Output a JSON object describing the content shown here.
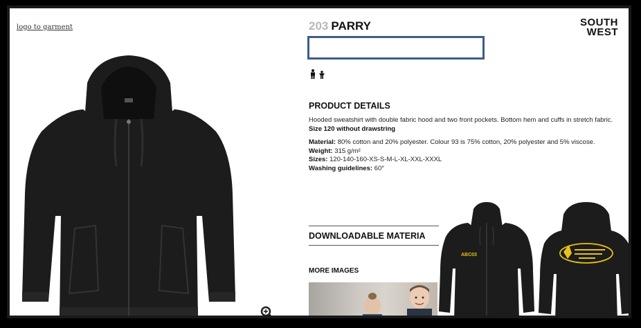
{
  "logo_link": "logo to garment",
  "product": {
    "number": "203",
    "name": "PARRY"
  },
  "brand_line1": "SOUTH",
  "brand_line2": "WEST",
  "details": {
    "heading": "PRODUCT DETAILS",
    "description": "Hooded sweatshirt with double fabric hood and two front pockets. Bottom hem and cuffs in stretch fabric.",
    "note": "Size 120 without drawstring",
    "material_label": "Material:",
    "material_value": " 80% cotton and 20% polyester. Colour 93 is 75% cotton, 20% polyester and 5% viscose.",
    "weight_label": "Weight:",
    "weight_value": " 315 g/m²",
    "sizes_label": "Sizes:",
    "sizes_value": " 120-140-160-XS-S-M-L-XL-XXL-XXXL",
    "washing_label": "Washing guidelines:",
    "washing_value": " 60°"
  },
  "downloadable": "DOWNLOADABLE MATERIA",
  "more_images": "MORE IMAGES",
  "print_front_text": "ABC03",
  "colors": {
    "garment": "#1c1c1c",
    "print": "#e8c11a",
    "select_border": "#3d5b8e"
  }
}
